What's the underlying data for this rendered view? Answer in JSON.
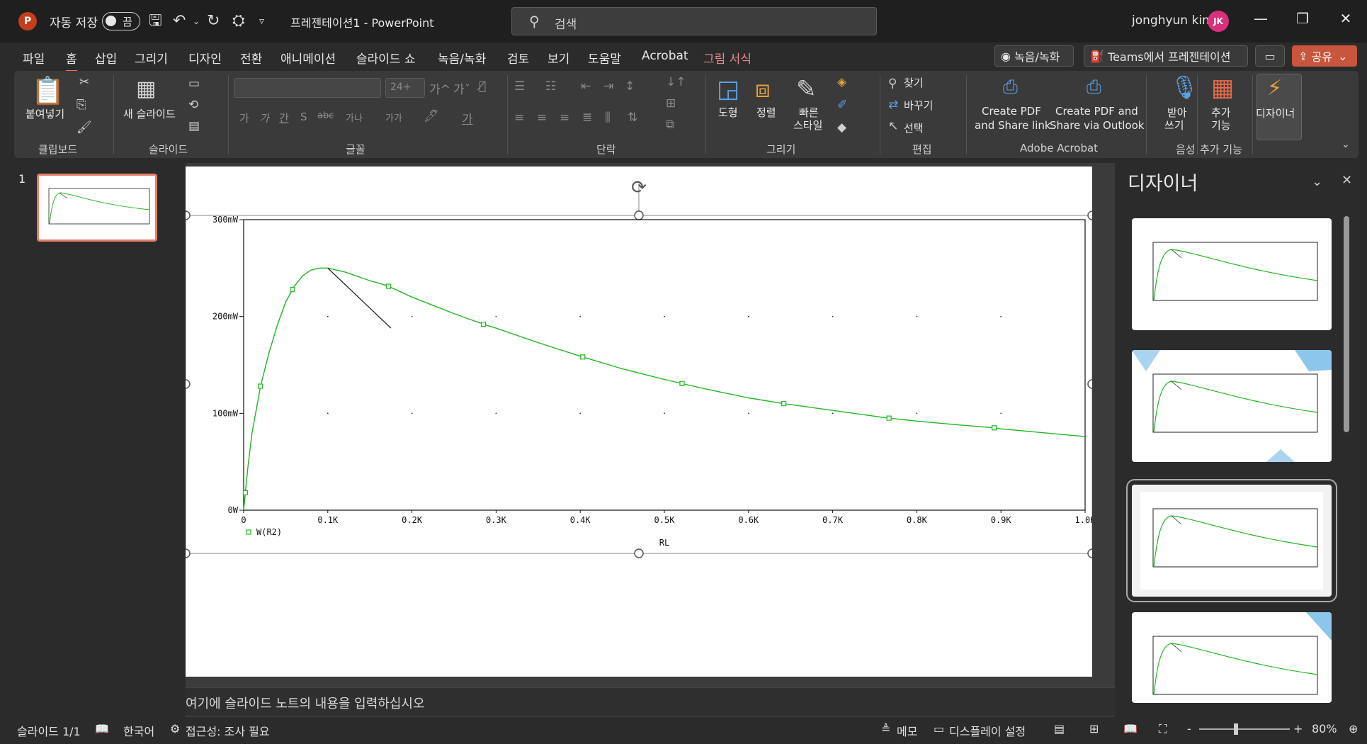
{
  "titlebar": {
    "app_icon": "P",
    "autosave_label": "자동 저장",
    "autosave_state": "끔",
    "doc_title": "프레젠테이션1  -  PowerPoint",
    "search_placeholder": "검색",
    "user_name": "jonghyun kim",
    "user_initials": "JK"
  },
  "menu": {
    "tabs": [
      "파일",
      "홈",
      "삽입",
      "그리기",
      "디자인",
      "전환",
      "애니메이션",
      "슬라이드 쇼",
      "녹음/녹화",
      "검토",
      "보기",
      "도움말",
      "Acrobat",
      "그림 서식"
    ],
    "active_tab": "홈",
    "record_button": "녹음/녹화",
    "teams_button": "Teams에서 프레젠테이션",
    "share_button": "공유"
  },
  "ribbon": {
    "clipboard": {
      "paste": "붙여넣기",
      "label": "클립보드"
    },
    "slides": {
      "new_slide": "새 슬라이드",
      "label": "슬라이드"
    },
    "font": {
      "size": "24+",
      "label": "글꼴"
    },
    "paragraph": {
      "label": "단락"
    },
    "drawing": {
      "shapes": "도형",
      "arrange": "정렬",
      "quick_styles_1": "빠른",
      "quick_styles_2": "스타일",
      "label": "그리기"
    },
    "editing": {
      "find": "찾기",
      "replace": "바꾸기",
      "select": "선택",
      "label": "편집"
    },
    "acrobat": {
      "pdf_link_1": "Create PDF",
      "pdf_link_2": "and Share link",
      "pdf_outlook_1": "Create PDF and",
      "pdf_outlook_2": "Share via Outlook",
      "label": "Adobe Acrobat"
    },
    "voice": {
      "dictate_1": "받아",
      "dictate_2": "쓰기",
      "label": "음성"
    },
    "addins": {
      "addins_1": "추가",
      "addins_2": "기능",
      "label": "추가 기능"
    },
    "designer": {
      "label": "디자이너"
    }
  },
  "thumbnails": {
    "slide_number": "1"
  },
  "chart_data": {
    "type": "line",
    "title": "",
    "xlabel": "RL",
    "ylabel": "",
    "x_ticks": [
      "0",
      "0.1K",
      "0.2K",
      "0.3K",
      "0.4K",
      "0.5K",
      "0.6K",
      "0.7K",
      "0.8K",
      "0.9K",
      "1.0K"
    ],
    "y_ticks": [
      "0W",
      "100mW",
      "200mW",
      "300mW"
    ],
    "xlim": [
      0,
      1000
    ],
    "ylim": [
      0,
      300
    ],
    "series": [
      {
        "name": "W(R2)",
        "color": "#22b522",
        "x": [
          0,
          2,
          5,
          10,
          20,
          30,
          40,
          50,
          60,
          70,
          80,
          90,
          100,
          120,
          150,
          170,
          200,
          250,
          285,
          300,
          350,
          400,
          450,
          500,
          520,
          550,
          600,
          642,
          700,
          750,
          767,
          800,
          850,
          892,
          900,
          950,
          1000
        ],
        "values": [
          0,
          18,
          44,
          80,
          128,
          162,
          191,
          215,
          231,
          242,
          248,
          250,
          250,
          246,
          237,
          232,
          220,
          203,
          192,
          188,
          173,
          159,
          146,
          135,
          131,
          125,
          116,
          110,
          103,
          97,
          95,
          92,
          88,
          85,
          84,
          80,
          76
        ]
      }
    ],
    "markers_x": [
      2,
      20,
      58,
      172,
      285,
      403,
      521,
      642,
      767,
      892
    ],
    "annotation_line": {
      "x": [
        100,
        175
      ],
      "y": [
        250,
        188
      ]
    },
    "legend": "bottom-left"
  },
  "slide_notes": "여기에 슬라이드 노트의 내용을 입력하십시오",
  "designer_pane": {
    "title": "디자이너"
  },
  "status": {
    "slide_counter": "슬라이드 1/1",
    "language": "한국어",
    "accessibility": "접근성: 조사 필요",
    "notes": "메모",
    "display_settings": "디스플레이 설정",
    "zoom_minus": "-",
    "zoom_plus": "+",
    "zoom": "80%"
  }
}
